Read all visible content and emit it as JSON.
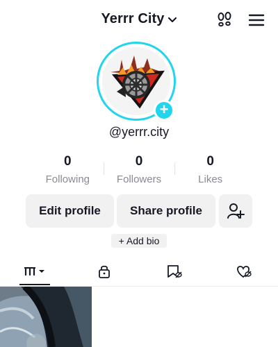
{
  "header": {
    "title": "Yerrr City",
    "title_dropdown_icon": "chevron-down-icon",
    "left_icon": "footsteps-icon",
    "right_icon": "hamburger-menu-icon"
  },
  "profile": {
    "handle": "@yerrr.city",
    "avatar_badge": "+"
  },
  "stats": [
    {
      "value": "0",
      "label": "Following"
    },
    {
      "value": "0",
      "label": "Followers"
    },
    {
      "value": "0",
      "label": "Likes"
    }
  ],
  "actions": {
    "edit_profile": "Edit profile",
    "share_profile": "Share profile",
    "add_friend_icon": "add-user-icon"
  },
  "bio": {
    "add_bio": "+ Add bio"
  },
  "tabs": [
    {
      "icon": "videos-grid-icon",
      "active": true
    },
    {
      "icon": "lock-icon",
      "active": false
    },
    {
      "icon": "bookmark-hidden-icon",
      "active": false
    },
    {
      "icon": "liked-hidden-icon",
      "active": false
    }
  ],
  "colors": {
    "accent": "#20d5ec",
    "text": "#161823",
    "muted": "#8a8b91",
    "button_bg": "#f1f1f2"
  }
}
